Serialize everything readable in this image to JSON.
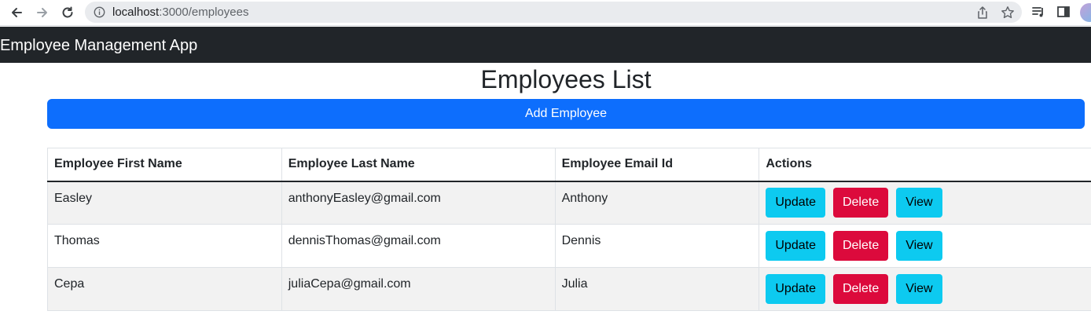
{
  "browser": {
    "url_host": "localhost",
    "url_path": ":3000/employees"
  },
  "navbar": {
    "brand": "Employee Management App"
  },
  "page": {
    "title": "Employees List",
    "add_button": "Add Employee"
  },
  "table": {
    "headers": [
      "Employee First Name",
      "Employee Last Name",
      "Employee Email Id",
      "Actions"
    ],
    "rows": [
      [
        "Easley",
        "anthonyEasley@gmail.com",
        "Anthony"
      ],
      [
        "Thomas",
        "dennisThomas@gmail.com",
        "Dennis"
      ],
      [
        "Cepa",
        "juliaCepa@gmail.com",
        "Julia"
      ]
    ],
    "actions": {
      "update": "Update",
      "delete": "Delete",
      "view": "View"
    }
  },
  "colors": {
    "navbar_bg": "#212529",
    "primary": "#0d6efd",
    "info": "#0dcaf0",
    "danger": "#dc0a3c"
  },
  "icons": [
    "back-arrow-icon",
    "forward-arrow-icon",
    "reload-icon",
    "info-icon",
    "share-icon",
    "star-icon",
    "media-queue-icon",
    "side-panel-icon",
    "profile-avatar"
  ]
}
